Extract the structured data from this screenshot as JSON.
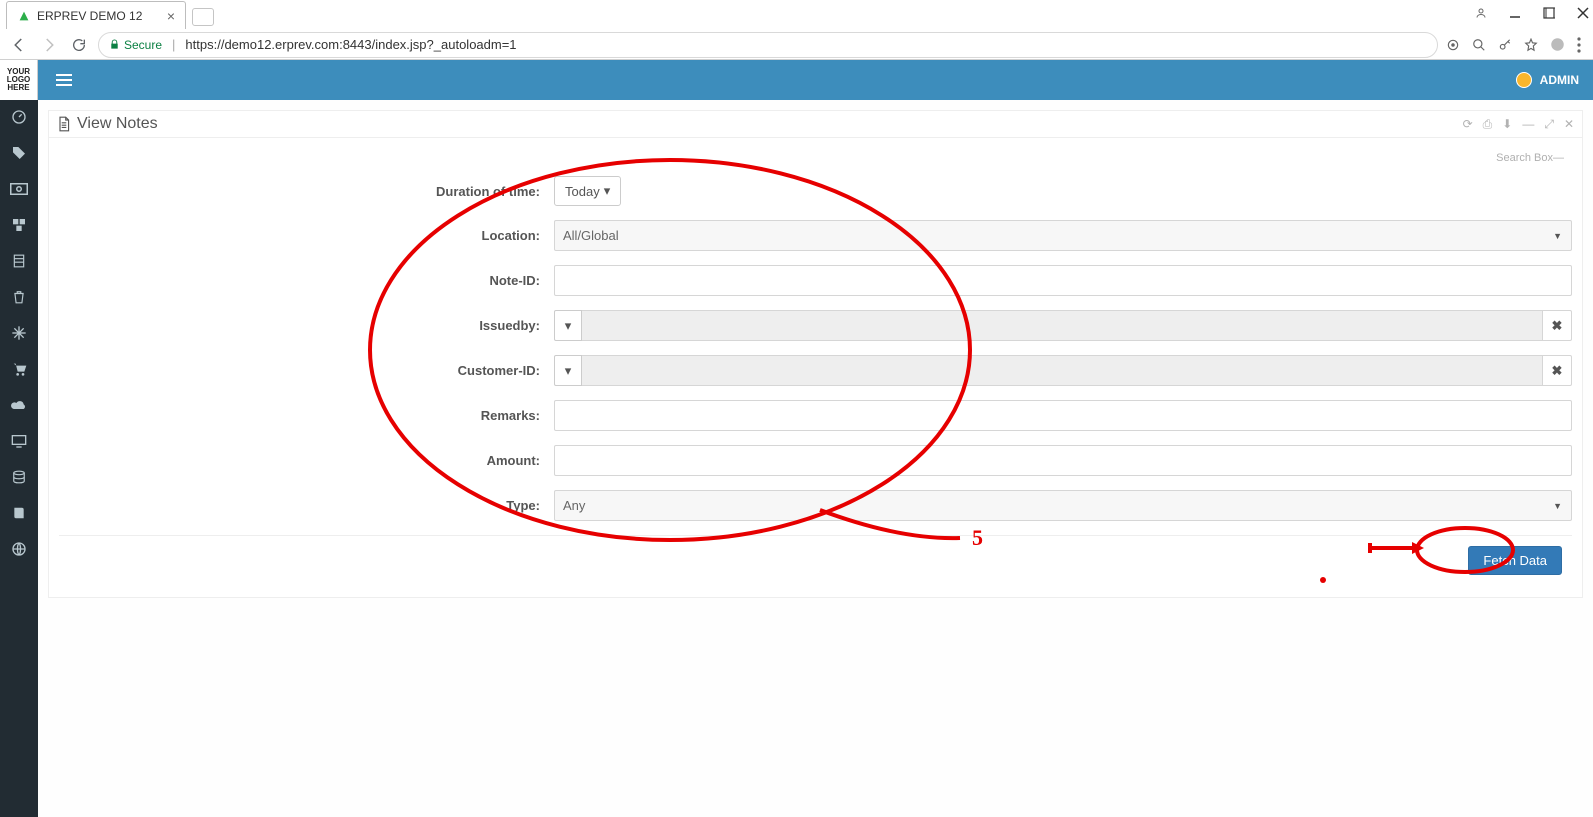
{
  "browser": {
    "tab_title": "ERPREV DEMO 12",
    "secure_label": "Secure",
    "url": "https://demo12.erprev.com:8443/index.jsp?_autoloadm=1"
  },
  "app": {
    "logo_text": "YOUR LOGO HERE",
    "user_label": "ADMIN"
  },
  "panel": {
    "title": "View Notes",
    "search_box_label": "Search Box"
  },
  "form": {
    "duration_label": "Duration of time:",
    "duration_value": "Today",
    "location_label": "Location:",
    "location_value": "All/Global",
    "noteid_label": "Note-ID:",
    "noteid_value": "",
    "issuedby_label": "Issuedby:",
    "issuedby_value": "",
    "customerid_label": "Customer-ID:",
    "customerid_value": "",
    "remarks_label": "Remarks:",
    "remarks_value": "",
    "amount_label": "Amount:",
    "amount_value": "",
    "type_label": "Type:",
    "type_value": "Any",
    "submit_label": "Fetch Data"
  },
  "annotation": {
    "number": "5"
  }
}
